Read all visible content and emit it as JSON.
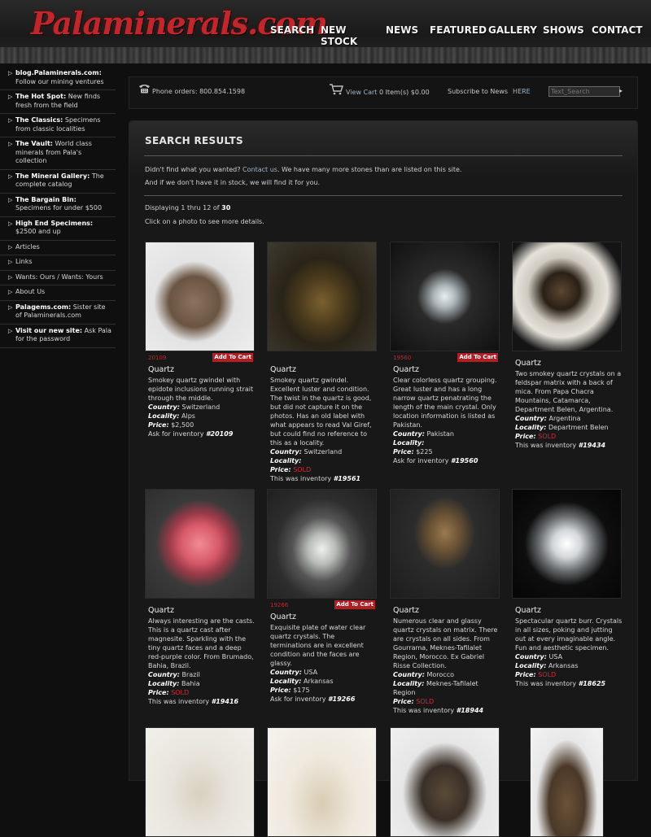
{
  "site": {
    "logo": "Palaminerals.com"
  },
  "nav": [
    "SEARCH",
    "NEW STOCK",
    "NEWS",
    "FEATURED",
    "GALLERY",
    "SHOWS",
    "CONTACT"
  ],
  "sidebar": [
    {
      "title": "blog.Palaminerals.com:",
      "text": "Follow our mining ventures"
    },
    {
      "title": "The Hot Spot:",
      "text": "New finds fresh from the field"
    },
    {
      "title": "The Classics:",
      "text": "Specimens from classic localities"
    },
    {
      "title": "The Vault:",
      "text": "World class minerals from Pala's collection"
    },
    {
      "title": "The Mineral Gallery:",
      "text": "The complete catalog"
    },
    {
      "title": "The Bargain Bin:",
      "text": "Specimens for under $500"
    },
    {
      "title": "High End Specimens:",
      "text": "$2500 and up"
    },
    {
      "title": "",
      "text": "Articles"
    },
    {
      "title": "",
      "text": "Links"
    },
    {
      "title": "",
      "text": "Wants: Ours / Wants: Yours"
    },
    {
      "title": "",
      "text": "About Us"
    },
    {
      "title": "Palagems.com:",
      "text": "Sister site of Palaminerals.com"
    },
    {
      "title": "Visit our new site:",
      "text": "Ask Pala for the password"
    }
  ],
  "topbar": {
    "phone": "Phone orders: 800.854.1598",
    "cart_label": "View Cart",
    "cart_count": "0 Item(s) $0.00",
    "subscribe": "Subscribe to News",
    "subscribe_link": "HERE",
    "search_placeholder": "Text_Search",
    "search_go": "▸"
  },
  "main": {
    "title": "SEARCH RESULTS",
    "not_found_prefix": "Didn't find what you wanted? ",
    "contact_link": "Contact us",
    "not_found_suffix": ". We have many more stones than are listed on this site.",
    "line2": "And if we don't have it in stock, we will find it for you.",
    "displaying_prefix": "Displaying 1 thru 12 of ",
    "total": "30",
    "click_hint": "Click on a photo to see more details."
  },
  "labels": {
    "add_to_cart": "Add To Cart",
    "country": "Country:",
    "locality": "Locality:",
    "price": "Price:",
    "ask_inventory": "Ask for inventory",
    "was_inventory": "This was inventory"
  },
  "products": [
    {
      "inv_small": "20109",
      "cart": true,
      "name": "Quartz",
      "desc": "Smokey quartz gwindel with epidote inclusions running strait through the middle.",
      "country": "Switzerland",
      "locality": "Alps",
      "price": "$2,500",
      "sold": false,
      "inventory": "#20109"
    },
    {
      "inv_small": "",
      "cart": false,
      "name": "Quartz",
      "desc": "Smokey quartz gwindel. Excellent luster and condition. The twist in the quartz is good, but did not capture it on the photos. Has an old label with what appears to read Val Giref, but could find no reference to this as a locality.",
      "country": "Switzerland",
      "locality": "",
      "price": "SOLD",
      "sold": true,
      "inventory": "#19561"
    },
    {
      "inv_small": "19560",
      "cart": true,
      "name": "Quartz",
      "desc": "Clear colorless quartz grouping. Great luster and has a long narrow quartz penatrating the length of the main crystal. Only location information is listed as Pakistan.",
      "country": "Pakistan",
      "locality": "",
      "price": "$225",
      "sold": false,
      "inventory": "#19560"
    },
    {
      "inv_small": "",
      "cart": false,
      "name": "Quartz",
      "desc": "Two smokey quartz crystals on a feldspar matrix with a back of mica. From Papa Chacra Mountains, Catamarca, Department Belen, Argentina.",
      "country": "Argentina",
      "locality": "Department Belen",
      "price": "SOLD",
      "sold": true,
      "inventory": "#19434"
    },
    {
      "inv_small": "",
      "cart": false,
      "name": "Quartz",
      "desc": "Always interesting are the casts. This is a quartz cast after magnesite. Sparkling with the tiny quartz faces and a deep red-purple color. From Brumado, Bahia, Brazil.",
      "country": "Brazil",
      "locality": "Bahia",
      "price": "SOLD",
      "sold": true,
      "inventory": "#19416"
    },
    {
      "inv_small": "19266",
      "cart": true,
      "name": "Quartz",
      "desc": "Exquisite plate of water clear quartz crystals. The terminations are in excellent condition and the faces are glassy.",
      "country": "USA",
      "locality": "Arkansas",
      "price": "$175",
      "sold": false,
      "inventory": "#19266"
    },
    {
      "inv_small": "",
      "cart": false,
      "name": "Quartz",
      "desc": "Numerous clear and glassy quartz crystals on matrix. There are crystals on all sides. From Gourrama, Meknes-Tafilalet Region, Morocco. Ex Gabriel Risse Collection.",
      "country": "Morocco",
      "locality": "Meknes-Tafilalet Region",
      "price": "SOLD",
      "sold": true,
      "inventory": "#18944"
    },
    {
      "inv_small": "",
      "cart": false,
      "name": "Quartz",
      "desc": "Spectacular quartz burr. Crystals in all sizes, poking and jutting out at every imaginable angle. Fun and aesthetic specimen.",
      "country": "USA",
      "locality": "Arkansas",
      "price": "SOLD",
      "sold": true,
      "inventory": "#18625"
    }
  ]
}
